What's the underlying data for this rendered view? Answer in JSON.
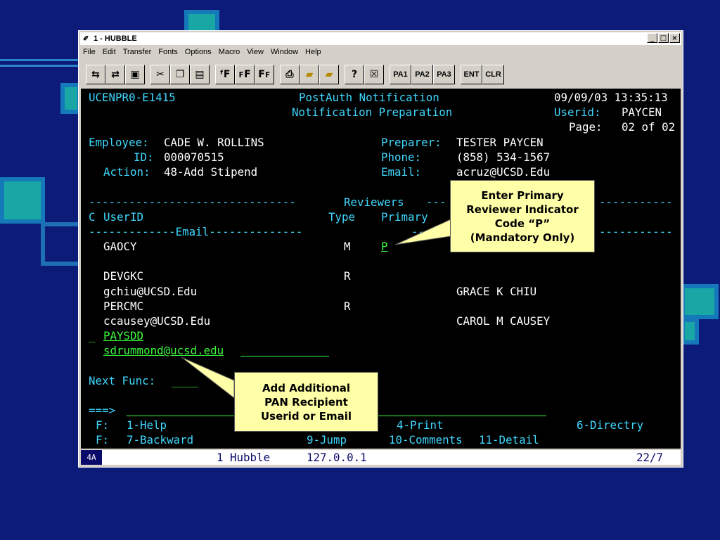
{
  "window": {
    "title": "1 - HUBBLE",
    "controls": [
      "_",
      "□",
      "×"
    ]
  },
  "menu": [
    "File",
    "Edit",
    "Transfer",
    "Fonts",
    "Options",
    "Macro",
    "View",
    "Window",
    "Help"
  ],
  "toolbar": {
    "icons": [
      "send-icon",
      "receive-icon",
      "save-icon",
      "cut-icon",
      "copy-icon",
      "paste-icon",
      "font-larger-icon",
      "font-f-icon",
      "font-smaller-icon",
      "print-icon",
      "folder-upload-icon",
      "folder-download-icon",
      "help-icon",
      "close-box-icon"
    ],
    "pa1": "PA1",
    "pa2": "PA2",
    "pa3": "PA3",
    "ent": "ENT",
    "clr": "CLR"
  },
  "screen": {
    "screen_id": "UCENPR0-E1415",
    "title1": "PostAuth Notification",
    "date_time": "09/09/03 13:35:13",
    "title2": "Notification Preparation",
    "userid_label": "Userid:",
    "userid_value": "PAYCEN",
    "page_label": "Page:",
    "page_value": "02 of 02",
    "employee_label": "Employee:",
    "employee_value": "CADE W. ROLLINS",
    "preparer_label": "Preparer:",
    "preparer_value": "TESTER PAYCEN",
    "id_label": "ID:",
    "id_value": "000070515",
    "phone_label": "Phone:",
    "phone_value": "(858) 534-1567",
    "action_label": "Action:",
    "action_value": "48-Add Stipend",
    "email_label": "Email:",
    "email_value": "acruz@UCSD.Edu",
    "dash_left": "-------------------------------",
    "reviewers_label": "Reviewers",
    "dash_mid": "---",
    "dash_right": "-----------",
    "col_c": "C",
    "col_userid": "UserID",
    "col_type": "Type",
    "col_primary": "Primary",
    "email_header": "-------------Email--------------",
    "dash_sub_mid": "--",
    "dash_sub_right": "-----------",
    "rows": [
      {
        "userid": "GAOCY",
        "type": "M",
        "primary": "P"
      },
      {
        "userid": "DEVGKC",
        "type": "R",
        "email": "gchiu@UCSD.Edu",
        "name": "GRACE K CHIU"
      },
      {
        "userid": "PERCMC",
        "type": "R",
        "email": "ccausey@UCSD.Edu",
        "name": "CAROL M CAUSEY"
      }
    ],
    "new_marker": "_",
    "new_userid": "PAYSDD",
    "new_email": "sdrummond@ucsd.edu",
    "next_func_label": "Next Func:",
    "next_func_value": "____",
    "cmd_prompt": "===>",
    "f1_label": "F:",
    "f1_help": "1-Help",
    "f1_print": "4-Print",
    "f1_directory": "6-Directry",
    "f2_label": "F:",
    "f2_backward": "7-Backward",
    "f2_jump": "9-Jump",
    "f2_comments": "10-Comments",
    "f2_detail": "11-Detail"
  },
  "status": {
    "indicator": "4A",
    "session": "1 Hubble",
    "host": "127.0.0.1",
    "cursor": "22/7"
  },
  "callouts": {
    "primary": [
      "Enter Primary",
      "Reviewer Indicator",
      "Code “P”",
      "(Mandatory Only)"
    ],
    "add": [
      "Add Additional",
      "PAN Recipient",
      "Userid or Email"
    ]
  }
}
